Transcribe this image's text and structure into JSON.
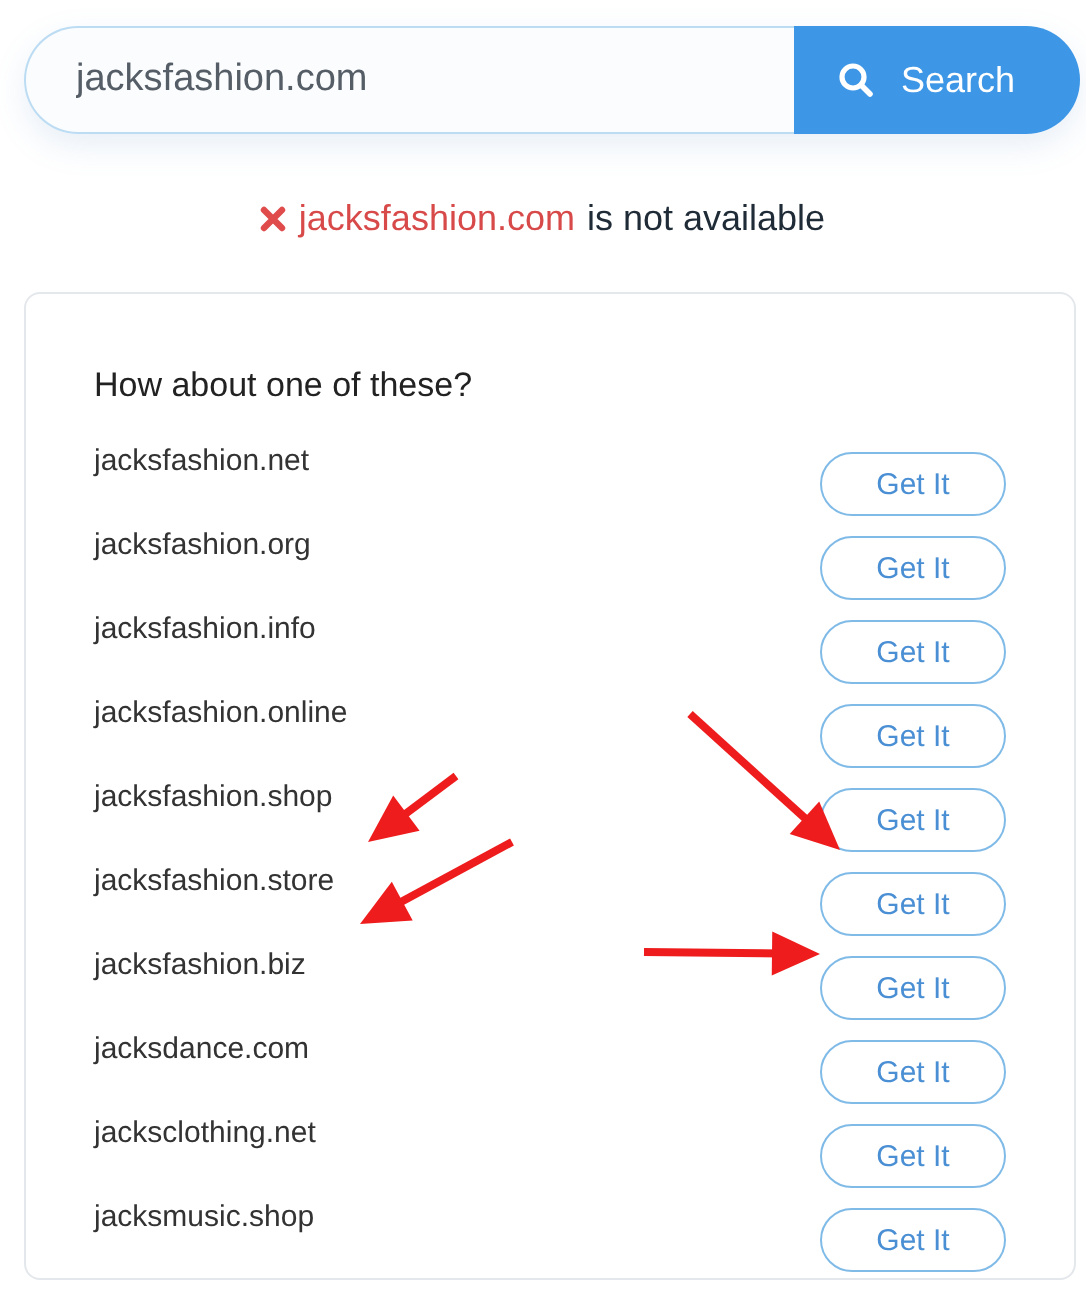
{
  "search": {
    "value": "jacksfashion.com",
    "button": "Search"
  },
  "status": {
    "domain": "jacksfashion.com",
    "message": "is not available",
    "available": false
  },
  "suggestions": {
    "heading": "How about one of these?",
    "items": [
      {
        "domain": "jacksfashion.net",
        "action": "Get It"
      },
      {
        "domain": "jacksfashion.org",
        "action": "Get It"
      },
      {
        "domain": "jacksfashion.info",
        "action": "Get It"
      },
      {
        "domain": "jacksfashion.online",
        "action": "Get It"
      },
      {
        "domain": "jacksfashion.shop",
        "action": "Get It"
      },
      {
        "domain": "jacksfashion.store",
        "action": "Get It"
      },
      {
        "domain": "jacksfashion.biz",
        "action": "Get It"
      },
      {
        "domain": "jacksdance.com",
        "action": "Get It"
      },
      {
        "domain": "jacksclothing.net",
        "action": "Get It"
      },
      {
        "domain": "jacksmusic.shop",
        "action": "Get It"
      }
    ]
  }
}
